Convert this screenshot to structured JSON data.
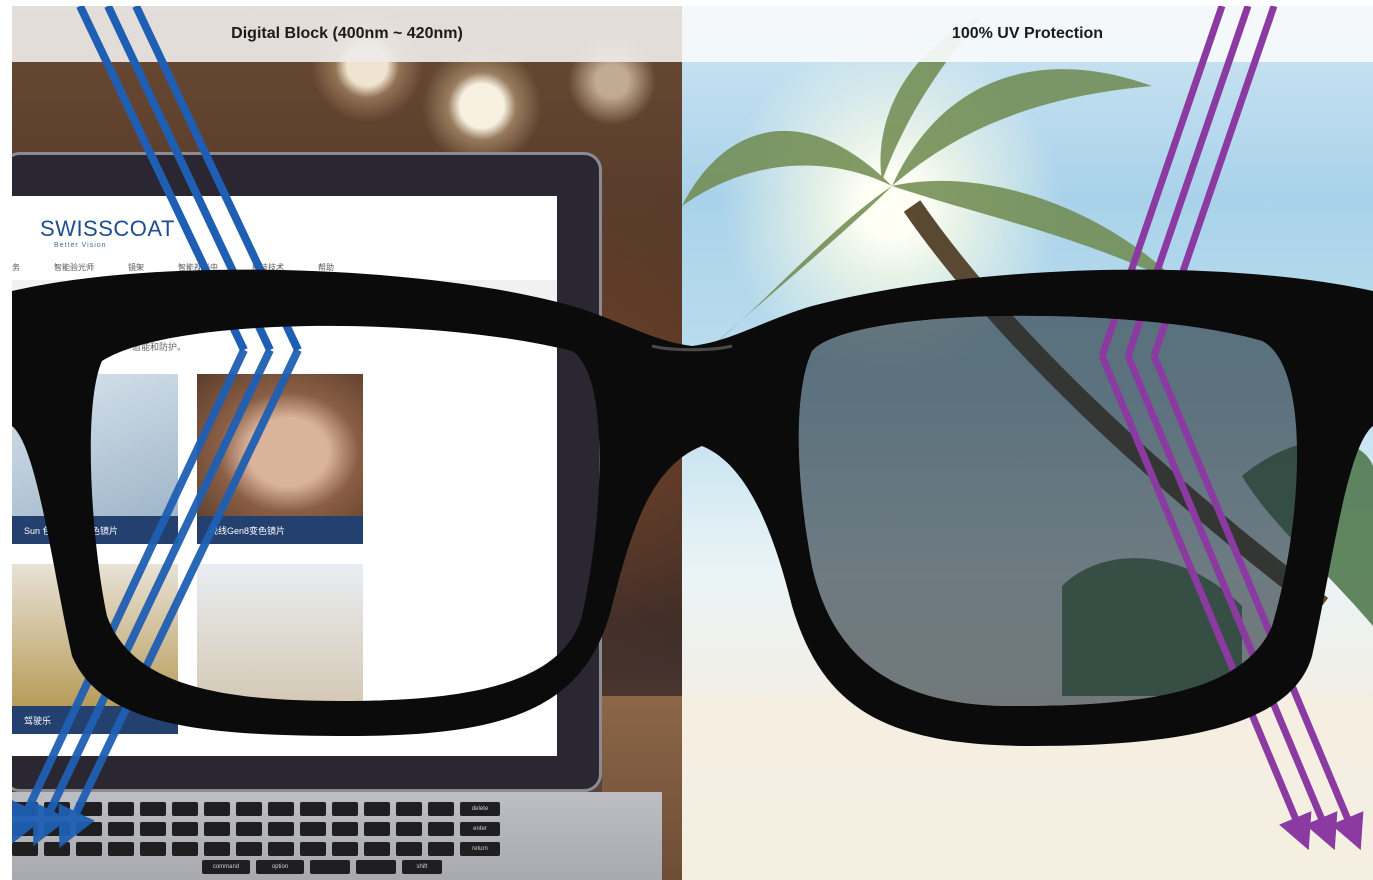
{
  "panels": {
    "left": {
      "title": "Digital Block (400nm ~ 420nm)"
    },
    "right": {
      "title": "100% UV Protection"
    }
  },
  "laptop_site": {
    "logo": "SWISSCOAT",
    "tagline": "Better Vision",
    "nav": [
      "务",
      "智能验光师",
      "镜架",
      "智能视光中",
      "科技技术",
      "帮助"
    ],
    "intro": "造能和防护。",
    "tiles": [
      {
        "caption": "Sun 色应」UV变色镜片"
      },
      {
        "caption": "视线Gen8变色镜片"
      },
      {
        "caption": "驾驶乐"
      },
      {
        "caption": ""
      }
    ]
  },
  "keyboard_labels": [
    "command",
    "option",
    "delete",
    "enter",
    "return",
    "shift"
  ],
  "colors": {
    "blue_ray": "#1f5fb3",
    "purple_ray": "#8a3aa0",
    "frame": "#0b0b0b",
    "header_left_bg": "#eeeae8",
    "header_right_bg": "#f6f9fb"
  }
}
